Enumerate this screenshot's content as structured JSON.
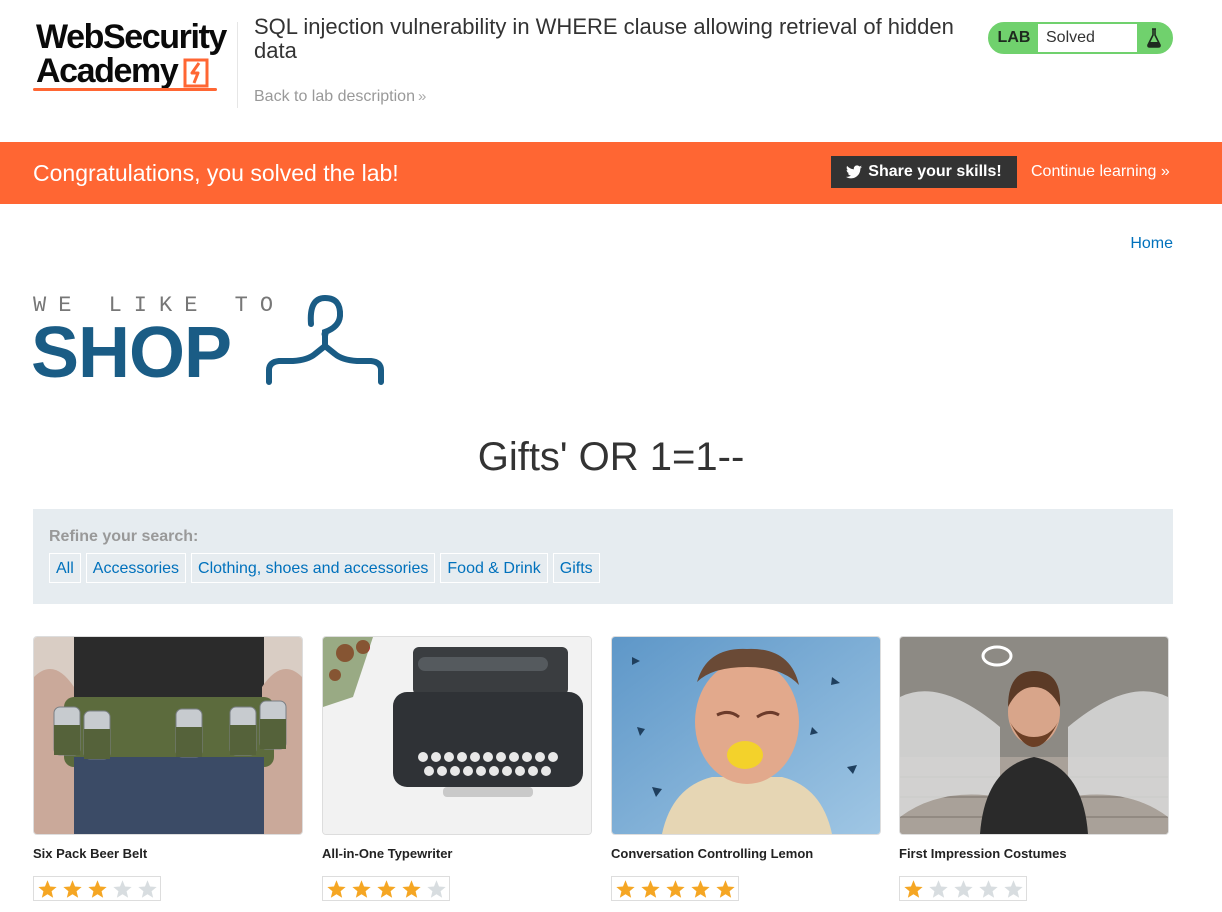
{
  "header": {
    "logo_line1": "WebSecurity",
    "logo_line2": "Academy",
    "lab_title": "SQL injection vulnerability in WHERE clause allowing retrieval of hidden data",
    "back_link": "Back to lab description",
    "lab_badge": "LAB",
    "lab_status": "Solved"
  },
  "banner": {
    "message": "Congratulations, you solved the lab!",
    "share_button": "Share your skills!",
    "continue_link": "Continue learning"
  },
  "nav": {
    "home": "Home"
  },
  "shop_logo": {
    "small": "WE LIKE TO",
    "big": "SHOP"
  },
  "search_heading": "Gifts' OR 1=1--",
  "filters": {
    "label": "Refine your search:",
    "items": [
      "All",
      "Accessories",
      "Clothing, shoes and accessories",
      "Food & Drink",
      "Gifts"
    ]
  },
  "products": [
    {
      "name": "Six Pack Beer Belt",
      "rating": 3,
      "image": "beer-belt-photo"
    },
    {
      "name": "All-in-One Typewriter",
      "rating": 4,
      "image": "typewriter-photo"
    },
    {
      "name": "Conversation Controlling Lemon",
      "rating": 5,
      "image": "lemon-man-photo"
    },
    {
      "name": "First Impression Costumes",
      "rating": 1,
      "image": "angel-costume-photo"
    }
  ],
  "colors": {
    "accent_orange": "#ff6633",
    "lab_green": "#70d16d",
    "link_blue": "#0071bc",
    "shop_blue": "#1a5c85",
    "star_filled": "#f5a623",
    "star_empty": "#d8dde0"
  }
}
